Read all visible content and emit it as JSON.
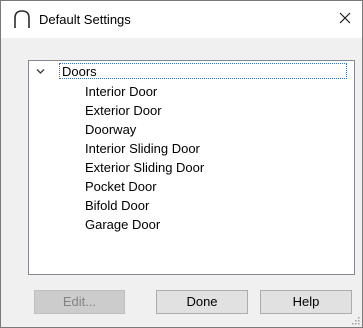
{
  "window": {
    "title": "Default Settings",
    "close_glyph": "✕"
  },
  "icons": {
    "app": "arch-icon",
    "close": "close-icon",
    "expander": "chevron-down-icon",
    "grip": "resize-grip-icon"
  },
  "tree": {
    "root": {
      "label": "Doors",
      "expanded": true,
      "selected": true
    },
    "children": [
      "Interior Door",
      "Exterior Door",
      "Doorway",
      "Interior Sliding Door",
      "Exterior Sliding Door",
      "Pocket Door",
      "Bifold Door",
      "Garage Door"
    ]
  },
  "buttons": {
    "edit": {
      "label": "Edit...",
      "enabled": false
    },
    "done": {
      "label": "Done",
      "enabled": true
    },
    "help": {
      "label": "Help",
      "enabled": true
    }
  },
  "colors": {
    "dialog_bg": "#f0f0f0",
    "titlebar_bg": "#ffffff",
    "focus_outline": "#3c6fb8",
    "button_bg": "#e1e1e1",
    "disabled_text": "#838383"
  }
}
